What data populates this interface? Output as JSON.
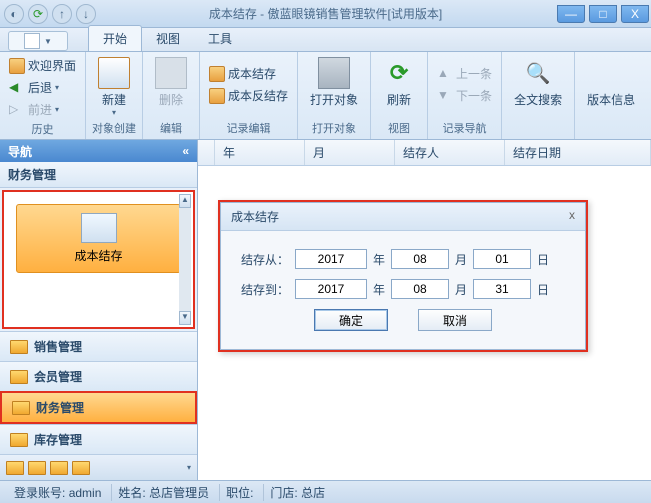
{
  "window": {
    "title_doc": "成本结存",
    "title_app": "傲蓝眼镜销售管理软件[试用版本]",
    "min": "—",
    "max": "□",
    "close": "X"
  },
  "menu": {
    "start": "开始",
    "view": "视图",
    "tools": "工具"
  },
  "ribbon": {
    "g1": {
      "welcome": "欢迎界面",
      "back": "后退",
      "forward": "前进",
      "label": "历史"
    },
    "g2": {
      "new": "新建",
      "label": "对象创建"
    },
    "g3": {
      "delete": "删除",
      "label": "编辑"
    },
    "g4": {
      "cost": "成本结存",
      "anti": "成本反结存",
      "label": "记录编辑"
    },
    "g5": {
      "open": "打开对象",
      "label": "打开对象"
    },
    "g6": {
      "refresh": "刷新",
      "label": "视图"
    },
    "g7": {
      "prev": "上一条",
      "next": "下一条",
      "label": "记录导航"
    },
    "g8": {
      "search": "全文搜索"
    },
    "g9": {
      "version": "版本信息"
    }
  },
  "nav": {
    "header": "导航",
    "section": "财务管理",
    "item_cost": "成本结存",
    "groups": {
      "sales": "销售管理",
      "member": "会员管理",
      "finance": "财务管理",
      "stock": "库存管理"
    }
  },
  "table": {
    "year": "年",
    "month": "月",
    "person": "结存人",
    "date": "结存日期"
  },
  "dialog": {
    "title": "成本结存",
    "from_label": "结存从：",
    "to_label": "结存到：",
    "from_year": "2017",
    "from_month": "08",
    "from_day": "01",
    "to_year": "2017",
    "to_month": "08",
    "to_day": "31",
    "unit_year": "年",
    "unit_month": "月",
    "unit_day": "日",
    "ok": "确定",
    "cancel": "取消"
  },
  "status": {
    "acct_label": "登录账号:",
    "acct": "admin",
    "name_label": "姓名:",
    "name": "总店管理员",
    "title_label": "职位:",
    "shop_label": "门店:",
    "shop": "总店"
  }
}
